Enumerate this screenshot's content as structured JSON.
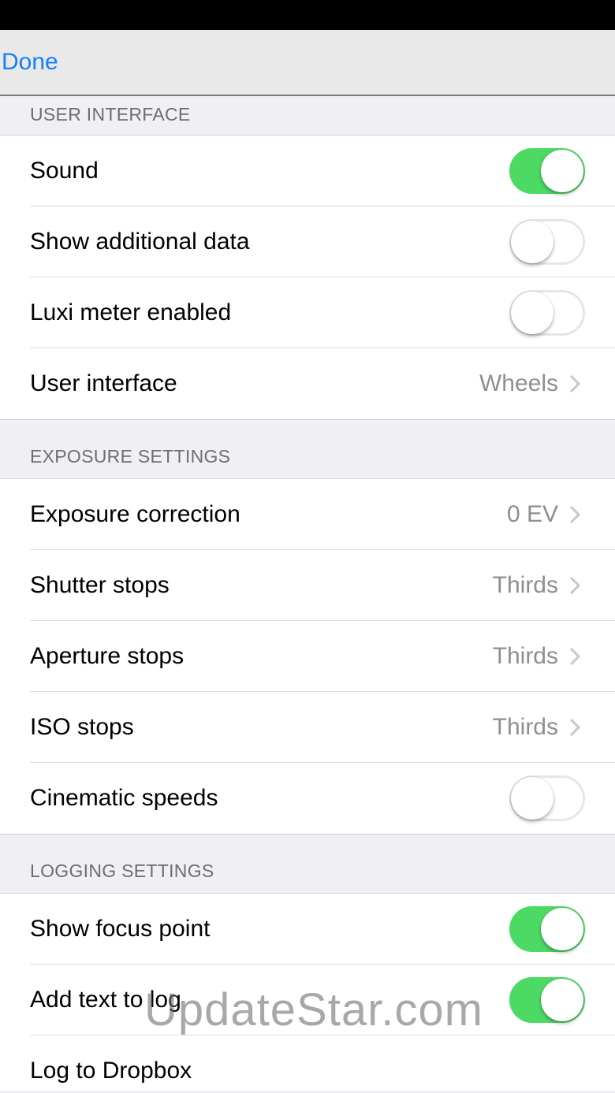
{
  "nav": {
    "done_label": "Done"
  },
  "sections": {
    "user_interface": {
      "header": "USER INTERFACE",
      "rows": [
        {
          "label": "Sound",
          "type": "toggle",
          "on": true
        },
        {
          "label": "Show additional data",
          "type": "toggle",
          "on": false
        },
        {
          "label": "Luxi meter enabled",
          "type": "toggle",
          "on": false
        },
        {
          "label": "User interface",
          "type": "disclosure",
          "value": "Wheels"
        }
      ]
    },
    "exposure": {
      "header": "EXPOSURE SETTINGS",
      "rows": [
        {
          "label": "Exposure correction",
          "type": "disclosure",
          "value": "0 EV"
        },
        {
          "label": "Shutter stops",
          "type": "disclosure",
          "value": "Thirds"
        },
        {
          "label": "Aperture stops",
          "type": "disclosure",
          "value": "Thirds"
        },
        {
          "label": "ISO stops",
          "type": "disclosure",
          "value": "Thirds"
        },
        {
          "label": "Cinematic speeds",
          "type": "toggle",
          "on": false
        }
      ]
    },
    "logging": {
      "header": "LOGGING SETTINGS",
      "rows": [
        {
          "label": "Show focus point",
          "type": "toggle",
          "on": true
        },
        {
          "label": "Add text to log",
          "type": "toggle",
          "on": true
        },
        {
          "label": "Log to Dropbox",
          "type": "disclosure-none"
        }
      ]
    }
  },
  "watermark": "UpdateStar.com",
  "colors": {
    "accent": "#157efb",
    "toggle_on": "#4cd964",
    "secondary_text": "#8e8e93"
  }
}
